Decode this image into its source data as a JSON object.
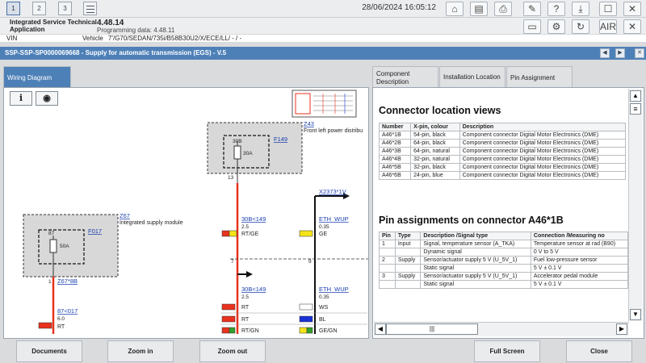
{
  "header": {
    "tabs": [
      "1",
      "2",
      "3"
    ],
    "datetime": "28/06/2024 16:05:12",
    "app_name": "Integrated Service Technical Application",
    "version": "4.48.14",
    "programming_data": "Programming data:  4.48.11",
    "vin_label": "VIN",
    "vehicle_label": "Vehicle",
    "vehicle_value": "7'/G70/SEDAN/735i/B58B30U2/X/ECE/LL/ - / -"
  },
  "title": "SSP-SSP-SP0000069668 - Supply for automatic transmission (EGS) - V.5",
  "tabs": {
    "wiring": "Wiring Diagram",
    "component": "Component Description",
    "installation": "Installation Location",
    "pins": "Pin Assignment"
  },
  "wiring": {
    "info_btn": "i",
    "z43_id": "Z43",
    "z43_name": "Front left power distribu",
    "f149": "F149",
    "f149_pin": "30B",
    "f149_amp": "30A",
    "pin13": "13",
    "z67_id": "Z67",
    "z67_name": "Integrated supply module",
    "f017": "F017",
    "f017_pin": "87",
    "f017_amp": "50A",
    "z67_conn": "Z67*8B",
    "pin1": "1",
    "w1_id": "30B<149",
    "w1_size": "2.5",
    "w1_color": "RT/GE",
    "w2_id": "ETH_WUP",
    "w2_size": "0.35",
    "w2_color": "GE",
    "x2373": "X2373*1V",
    "pin7": "7",
    "pin9": "9",
    "w3_id": "30B<149",
    "w3_size": "2.5",
    "w3_color": "RT",
    "w4_id": "ETH_WUP",
    "w4_size": "0.35",
    "w4_color": "WS",
    "w5_color": "RT",
    "w6_color": "BL",
    "w7_color": "RT/GN",
    "w8_color": "GE/GN",
    "w9_id": "87<017",
    "w9_size": "6.0",
    "w9_color": "RT",
    "colors": {
      "red": "#e8321e",
      "yellow": "#f5e31b",
      "blue": "#1832d6",
      "green": "#33a02c",
      "black": "#111111"
    }
  },
  "connectors": {
    "heading": "Connector location views",
    "columns": [
      "Number",
      "X-pin, colour",
      "Description"
    ],
    "rows": [
      [
        "A46*1B",
        "54-pin, black",
        "Component connector Digital Motor Electronics (DME)"
      ],
      [
        "A46*2B",
        "64-pin, black",
        "Component connector Digital Motor Electronics (DME)"
      ],
      [
        "A46*3B",
        "64-pin, natural",
        "Component connector Digital Motor Electronics (DME)"
      ],
      [
        "A46*4B",
        "32-pin, natural",
        "Component connector Digital Motor Electronics (DME)"
      ],
      [
        "A46*5B",
        "32-pin, black",
        "Component connector Digital Motor Electronics (DME)"
      ],
      [
        "A46*6B",
        "24-pin, blue",
        "Component connector Digital Motor Electronics (DME)"
      ]
    ]
  },
  "pins": {
    "heading": "Pin assignments on connector A46*1B",
    "columns": [
      "Pin",
      "Type",
      "Description /Signal type",
      "Connection /Measuring no"
    ],
    "rows": [
      [
        "1",
        "Input",
        "Signal, temperature sensor (A_TKA)",
        "Temperature sensor at rad (B90)"
      ],
      [
        "",
        "",
        "Dynamic signal",
        "0 V to 5 V"
      ],
      [
        "2",
        "Supply",
        "Sensor/actuator supply 5 V (U_5V_1)",
        "Fuel low-pressure sensor"
      ],
      [
        "",
        "",
        "Static signal",
        "5 V ± 0.1 V"
      ],
      [
        "3",
        "Supply",
        "Sensor/actuator supply 5 V (U_5V_1)",
        "Accelerator pedal module"
      ],
      [
        "",
        "",
        "Static signal",
        "5 V ± 0.1 V"
      ]
    ]
  },
  "buttons": {
    "documents": "Documents",
    "zoom_in": "Zoom in",
    "zoom_out": "Zoom out",
    "full_screen": "Full Screen",
    "close": "Close"
  }
}
